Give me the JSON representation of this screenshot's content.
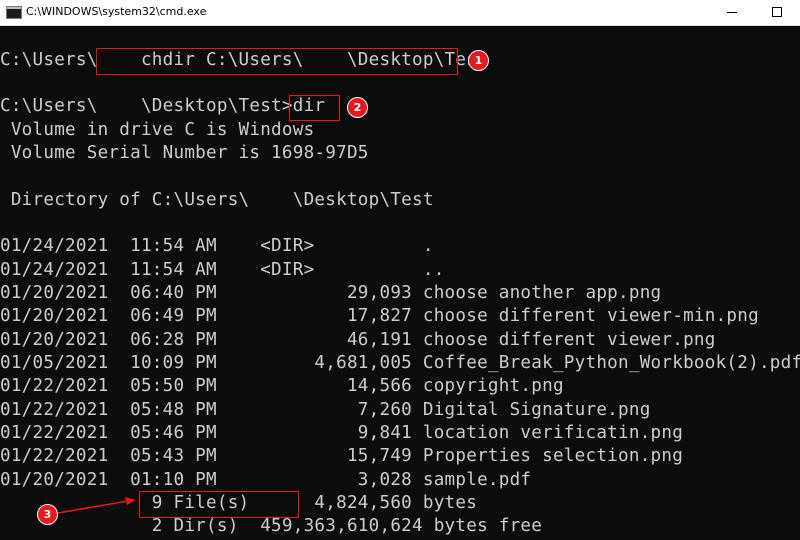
{
  "window": {
    "title": "C:\\WINDOWS\\system32\\cmd.exe",
    "icon": "cmd-icon"
  },
  "console": {
    "lines": [
      "",
      "C:\\Users\\    chdir C:\\Users\\    \\Desktop\\Test",
      "",
      "C:\\Users\\    \\Desktop\\Test>dir",
      " Volume in drive C is Windows",
      " Volume Serial Number is 1698-97D5",
      "",
      " Directory of C:\\Users\\    \\Desktop\\Test",
      "",
      "01/24/2021  11:54 AM    <DIR>          .",
      "01/24/2021  11:54 AM    <DIR>          ..",
      "01/20/2021  06:40 PM            29,093 choose another app.png",
      "01/20/2021  06:49 PM            17,827 choose different viewer-min.png",
      "01/20/2021  06:28 PM            46,191 choose different viewer.png",
      "01/05/2021  10:09 PM         4,681,005 Coffee_Break_Python_Workbook(2).pdf",
      "01/22/2021  05:50 PM            14,566 copyright.png",
      "01/22/2021  05:48 PM             7,260 Digital Signature.png",
      "01/22/2021  05:46 PM             9,841 location verificatin.png",
      "01/22/2021  05:43 PM            15,749 Properties selection.png",
      "01/20/2021  01:10 PM             3,028 sample.pdf",
      "              9 File(s)      4,824,560 bytes",
      "              2 Dir(s)  459,363,610,624 bytes free"
    ]
  },
  "annotations": {
    "badge_1": "1",
    "badge_2": "2",
    "badge_3": "3",
    "color": "#e8161b"
  }
}
